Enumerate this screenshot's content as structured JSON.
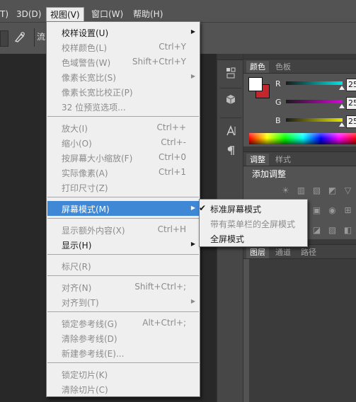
{
  "menubar": {
    "items": [
      {
        "label": "T)"
      },
      {
        "label": "3D(D)"
      },
      {
        "label": "视图(V)"
      },
      {
        "label": "窗口(W)"
      },
      {
        "label": "帮助(H)"
      }
    ]
  },
  "options_bar": {
    "partial_text": "流"
  },
  "view_menu": {
    "items": [
      {
        "label": "校样设置(U)",
        "shortcut": "",
        "submenu": true,
        "enabled": true
      },
      {
        "label": "校样颜色(L)",
        "shortcut": "Ctrl+Y",
        "enabled": false
      },
      {
        "label": "色域警告(W)",
        "shortcut": "Shift+Ctrl+Y",
        "enabled": false
      },
      {
        "label": "像素长宽比(S)",
        "shortcut": "",
        "submenu": true,
        "enabled": false
      },
      {
        "label": "像素长宽比校正(P)",
        "shortcut": "",
        "enabled": false
      },
      {
        "label": "32 位预览选项...",
        "shortcut": "",
        "enabled": false
      },
      {
        "label": "放大(I)",
        "shortcut": "Ctrl++",
        "enabled": false
      },
      {
        "label": "缩小(O)",
        "shortcut": "Ctrl+-",
        "enabled": false
      },
      {
        "label": "按屏幕大小缩放(F)",
        "shortcut": "Ctrl+0",
        "enabled": false
      },
      {
        "label": "实际像素(A)",
        "shortcut": "Ctrl+1",
        "enabled": false
      },
      {
        "label": "打印尺寸(Z)",
        "shortcut": "",
        "enabled": false
      },
      {
        "label": "屏幕模式(M)",
        "shortcut": "",
        "submenu": true,
        "enabled": true,
        "highlighted": true
      },
      {
        "label": "显示额外内容(X)",
        "shortcut": "Ctrl+H",
        "enabled": false
      },
      {
        "label": "显示(H)",
        "shortcut": "",
        "submenu": true,
        "enabled": true
      },
      {
        "label": "标尺(R)",
        "shortcut": "",
        "enabled": false
      },
      {
        "label": "对齐(N)",
        "shortcut": "Shift+Ctrl+;",
        "enabled": false
      },
      {
        "label": "对齐到(T)",
        "shortcut": "",
        "submenu": true,
        "enabled": false
      },
      {
        "label": "锁定参考线(G)",
        "shortcut": "Alt+Ctrl+;",
        "enabled": false
      },
      {
        "label": "清除参考线(D)",
        "shortcut": "",
        "enabled": false
      },
      {
        "label": "新建参考线(E)...",
        "shortcut": "",
        "enabled": false
      },
      {
        "label": "锁定切片(K)",
        "shortcut": "",
        "enabled": false
      },
      {
        "label": "清除切片(C)",
        "shortcut": "",
        "enabled": false
      }
    ]
  },
  "screen_mode_submenu": {
    "items": [
      {
        "label": "标准屏幕模式",
        "checked": true,
        "enabled": true
      },
      {
        "label": "带有菜单栏的全屏模式",
        "checked": false,
        "enabled": false
      },
      {
        "label": "全屏模式",
        "checked": false,
        "enabled": true
      }
    ],
    "check_glyph": "✔"
  },
  "color_panel": {
    "tabs": [
      {
        "label": "颜色"
      },
      {
        "label": "色板"
      }
    ],
    "channels": [
      {
        "label": "R",
        "value": "25",
        "color": "#00e5e5"
      },
      {
        "label": "G",
        "value": "25",
        "color": "#e000e0"
      },
      {
        "label": "B",
        "value": "25",
        "color": "#e5e500"
      }
    ],
    "foreground": "#ffffff",
    "background": "#c4262e"
  },
  "adjustments_panel": {
    "tabs": [
      {
        "label": "调整"
      },
      {
        "label": "样式"
      }
    ],
    "title": "添加调整"
  },
  "layers_panel": {
    "tabs": [
      {
        "label": "图层"
      },
      {
        "label": "通道"
      },
      {
        "label": "路径"
      }
    ]
  }
}
